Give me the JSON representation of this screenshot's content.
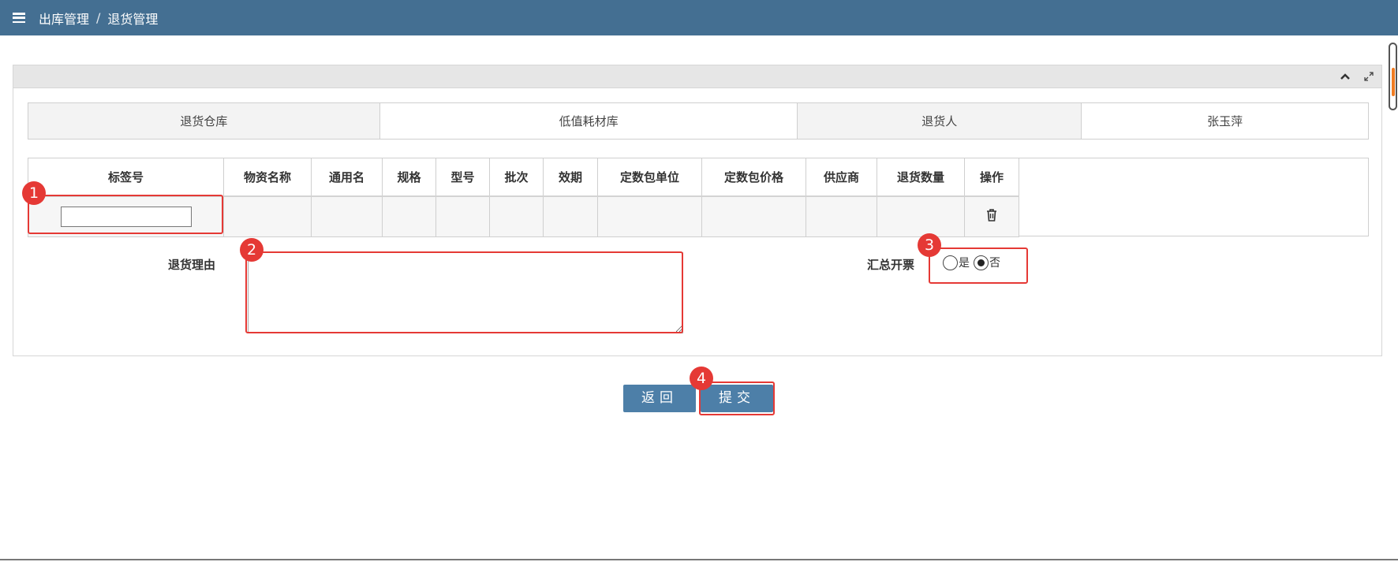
{
  "breadcrumb": {
    "section": "出库管理",
    "separator": "/",
    "page": "退货管理"
  },
  "info": {
    "warehouse_label": "退货仓库",
    "warehouse_value": "低值耗材库",
    "returner_label": "退货人",
    "returner_value": "张玉萍"
  },
  "grid": {
    "columns": [
      "标签号",
      "物资名称",
      "通用名",
      "规格",
      "型号",
      "批次",
      "效期",
      "定数包单位",
      "定数包价格",
      "供应商",
      "退货数量",
      "操作"
    ],
    "row": {
      "tag_value": ""
    }
  },
  "form": {
    "reason_label": "退货理由",
    "reason_value": "",
    "invoice_label": "汇总开票",
    "invoice_options": [
      {
        "label": "是",
        "checked": false
      },
      {
        "label": "否",
        "checked": true
      }
    ]
  },
  "buttons": {
    "back": "返回",
    "submit": "提交"
  },
  "annotations": [
    "1",
    "2",
    "3",
    "4"
  ],
  "colors": {
    "topbar": "#446f92",
    "button": "#4d7fa8",
    "highlight": "#e53935"
  }
}
